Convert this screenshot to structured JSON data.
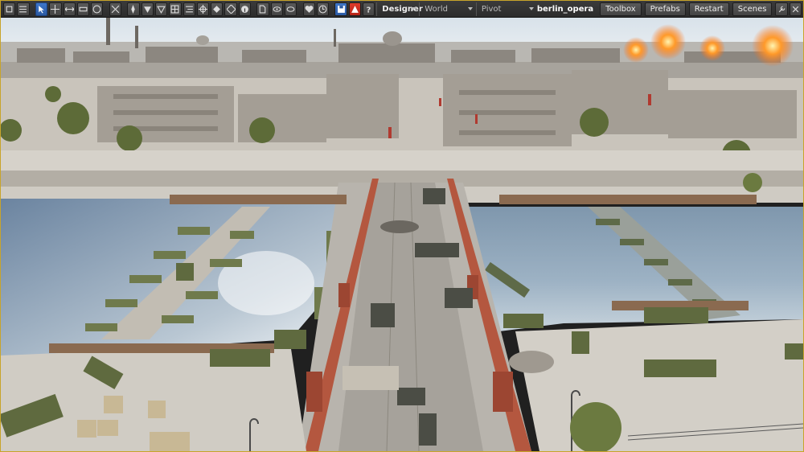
{
  "toolbar": {
    "mode": "Designer",
    "space": "World",
    "pivot": "Pivot",
    "scene_name": "berlin_opera",
    "buttons": {
      "toolbox": "Toolbox",
      "prefabs": "Prefabs",
      "restart": "Restart",
      "scenes": "Scenes"
    }
  },
  "colors": {
    "accent_border": "#c8a42a",
    "active_tool": "#3f77c9",
    "warning": "#e03b2b"
  }
}
